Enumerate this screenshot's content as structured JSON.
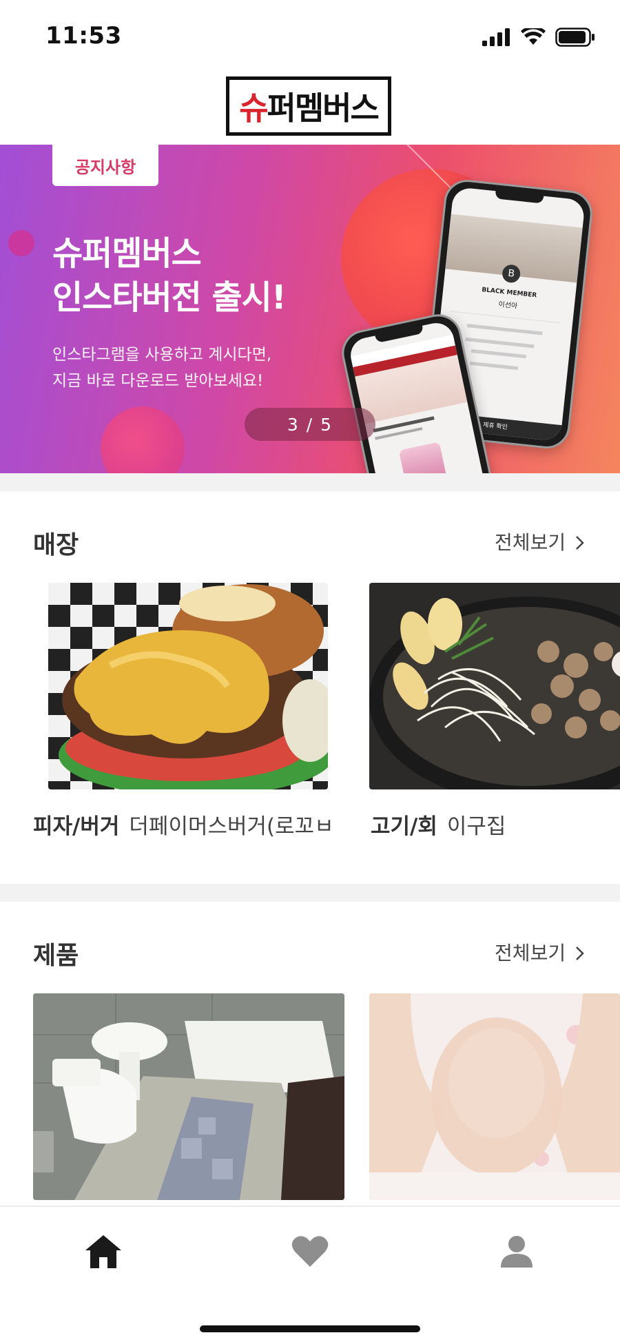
{
  "status_bar": {
    "time": "11:53"
  },
  "header": {
    "logo_text_first": "슈",
    "logo_text_rest": "퍼멤버스"
  },
  "banner": {
    "tag": "공지사항",
    "title_line1": "슈퍼멤버스",
    "title_line2": "인스타버전 출시!",
    "subtitle_line1": "인스타그램을 사용하고 계시다면,",
    "subtitle_line2": "지금 바로 다운로드 받아보세요!",
    "slide_indicator": "3 / 5",
    "phone_back_text_member": "BLACK MEMBER",
    "phone_back_text_name": "이선아",
    "phone_back_button": "제휴 확인"
  },
  "stores": {
    "title": "매장",
    "view_all": "전체보기",
    "items": [
      {
        "category": "피자/버거",
        "name": "더페이머스버거(로꼬ㅂ"
      },
      {
        "category": "고기/회",
        "name": "이구집"
      }
    ]
  },
  "products": {
    "title": "제품",
    "view_all": "전체보기"
  },
  "tab_bar": {
    "items": [
      "home-icon",
      "heart-icon",
      "profile-icon"
    ],
    "active_color": "#1a1a1a",
    "inactive_color": "#8e8e8e"
  },
  "colors": {
    "accent_red": "#d9232d",
    "tag_pink": "#d63a67"
  }
}
